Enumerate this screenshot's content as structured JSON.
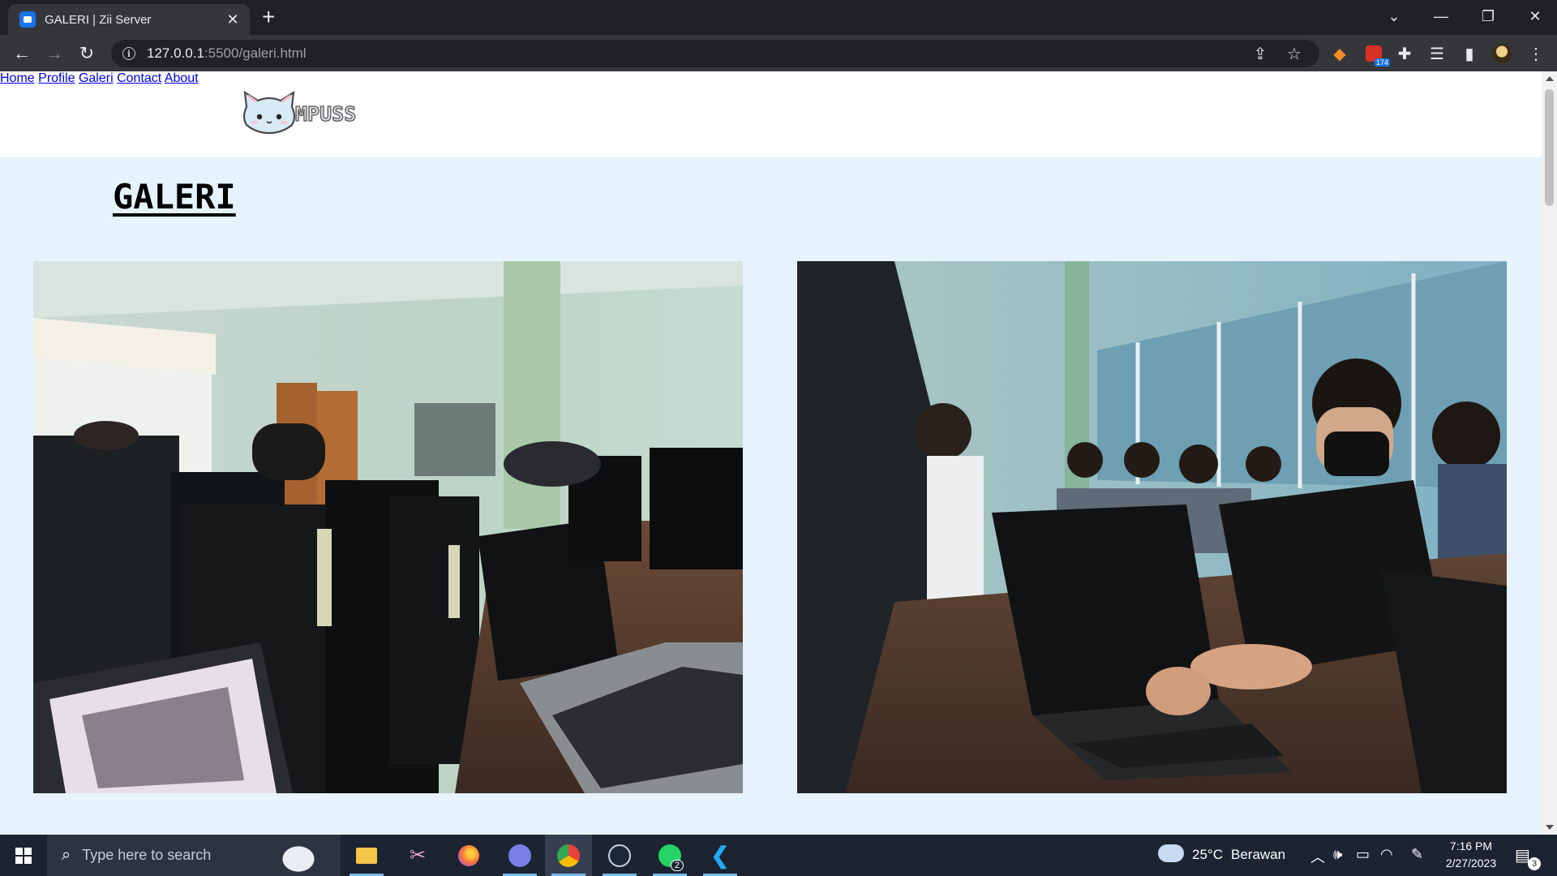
{
  "browser": {
    "tab_title": "GALERI | Zii Server",
    "url_host": "127.0.0.1",
    "url_rest": ":5500/galeri.html"
  },
  "site": {
    "logo_text": "MPUSS",
    "nav": [
      "Home",
      "Profile",
      "Galeri",
      "Contact",
      "About"
    ],
    "page_title": "GALERI"
  },
  "gallery": [
    {
      "subject": "computer-lab-desktops-photo"
    },
    {
      "subject": "students-using-laptops-photo"
    }
  ],
  "taskbar": {
    "search_placeholder": "Type here to search",
    "weather_temp": "25°C",
    "weather_desc": "Berawan",
    "time": "7:16 PM",
    "date": "2/27/2023",
    "notification_count": "3",
    "whatsapp_badge": "2",
    "extension_badge": "174"
  },
  "colors": {
    "page_bg": "#e6f3fc",
    "nav_link": "#1f5d86",
    "header_bg": "#ffffff"
  }
}
